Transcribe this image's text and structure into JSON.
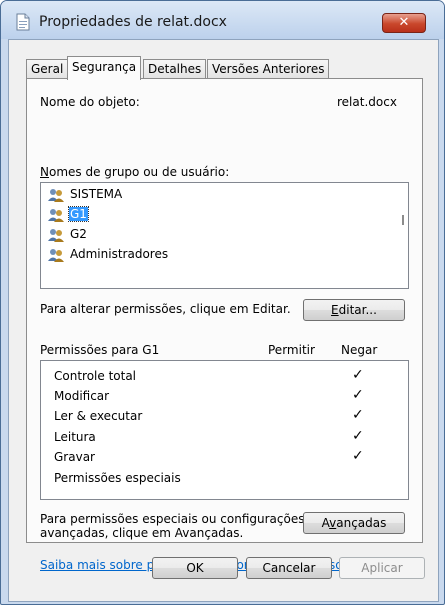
{
  "window": {
    "title": "Propriedades de relat.docx",
    "close_label": "✕"
  },
  "tabs": [
    {
      "label": "Geral"
    },
    {
      "label": "Segurança"
    },
    {
      "label": "Detalhes"
    },
    {
      "label": "Versões Anteriores"
    }
  ],
  "object": {
    "label": "Nome do objeto:",
    "value": "relat.docx"
  },
  "groups": {
    "label_prefix": "N",
    "label_rest": "omes de grupo ou de usuário:",
    "items": [
      {
        "name": "SISTEMA"
      },
      {
        "name": "G1"
      },
      {
        "name": "G2"
      },
      {
        "name": "Administradores"
      }
    ],
    "selected": "G1"
  },
  "edit": {
    "text": "Para alterar permissões, clique em Editar.",
    "button_prefix": "E",
    "button_rest": "ditar..."
  },
  "permissions": {
    "title": "Permissões para G1",
    "col_allow": "Permitir",
    "col_deny": "Negar",
    "rows": [
      {
        "name": "Controle total",
        "deny": "✓"
      },
      {
        "name": "Modificar",
        "deny": "✓"
      },
      {
        "name": "Ler & executar",
        "deny": "✓"
      },
      {
        "name": "Leitura",
        "deny": "✓"
      },
      {
        "name": "Gravar",
        "deny": "✓"
      },
      {
        "name": "Permissões especiais",
        "deny": ""
      }
    ]
  },
  "advanced": {
    "text_line1": "Para permissões especiais ou configurações",
    "text_line2": "avançadas, clique em Avançadas.",
    "button_prefix": "A",
    "button_underlined": "v",
    "button_rest": "ançadas"
  },
  "link": {
    "text": "Saiba mais sobre permissões e controle de acesso"
  },
  "footer": {
    "ok": "OK",
    "cancel": "Cancelar",
    "apply": "Aplicar"
  },
  "colors": {
    "selection": "#3399ff",
    "close_button": "#c9472b",
    "link": "#0066cc"
  }
}
